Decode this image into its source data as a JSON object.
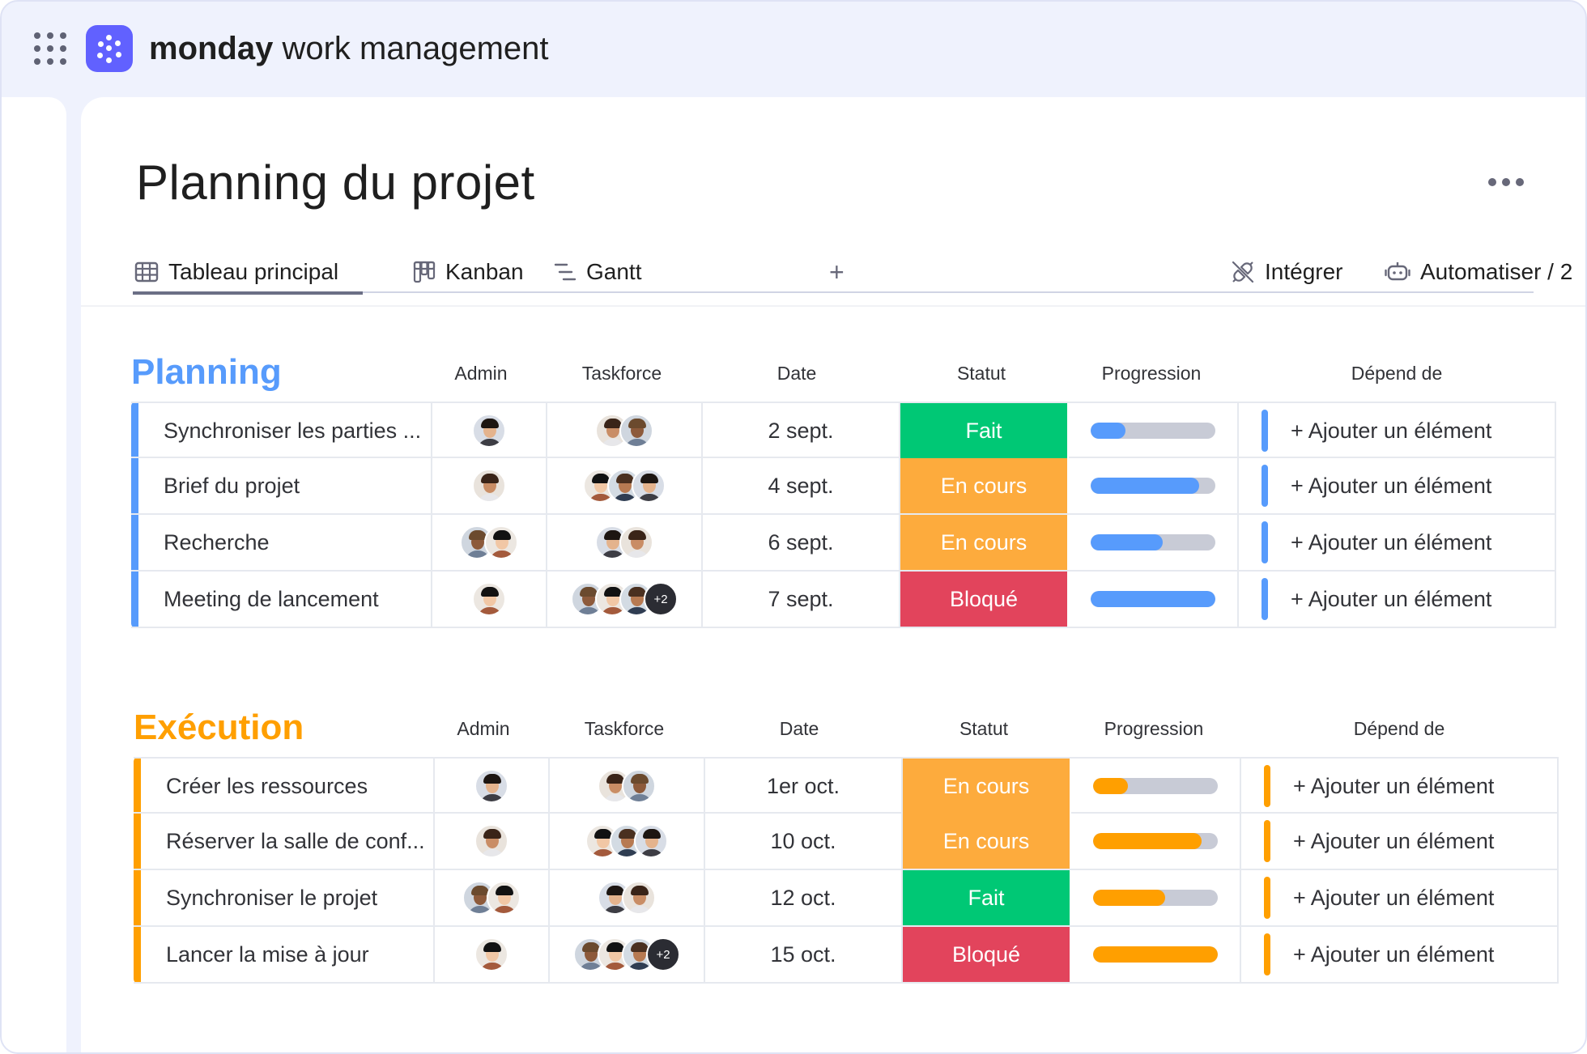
{
  "app": {
    "brand_bold": "monday",
    "brand_rest": " work management"
  },
  "page": {
    "title": "Planning du projet"
  },
  "tabs": [
    {
      "label": "Tableau principal",
      "icon": "table-icon",
      "active": true
    },
    {
      "label": "Kanban",
      "icon": "kanban-icon",
      "active": false
    },
    {
      "label": "Gantt",
      "icon": "gantt-icon",
      "active": false
    }
  ],
  "add_tab_label": "+",
  "actions": {
    "integrate": "Intégrer",
    "automate": "Automatiser / 2"
  },
  "columns": {
    "admin": "Admin",
    "taskforce": "Taskforce",
    "date": "Date",
    "status": "Statut",
    "progress": "Progression",
    "depends": "Dépend de"
  },
  "colors": {
    "planning": "#579bfc",
    "execution": "#ff9f00",
    "done": "#00c875",
    "working": "#fdab3d",
    "stuck": "#e2445c",
    "bar_bg": "#c8cbd6"
  },
  "groups": [
    {
      "title": "Planning",
      "rows": [
        {
          "name": "Synchroniser les parties ...",
          "date": "2 sept.",
          "status": "Fait",
          "progress": 0.28,
          "depends": "+ Ajouter un élément"
        },
        {
          "name": "Brief du projet",
          "date": "4 sept.",
          "status": "En cours",
          "progress": 0.87,
          "depends": "+ Ajouter un élément"
        },
        {
          "name": "Recherche",
          "date": "6 sept.",
          "status": "En cours",
          "progress": 0.58,
          "depends": "+ Ajouter un élément"
        },
        {
          "name": "Meeting de lancement",
          "date": "7 sept.",
          "status": "Bloqué",
          "progress": 1.0,
          "depends": "+ Ajouter un élément"
        }
      ],
      "extra_count": "+2"
    },
    {
      "title": "Exécution",
      "rows": [
        {
          "name": "Créer les ressources",
          "date": "1er oct.",
          "status": "En cours",
          "progress": 0.28,
          "depends": "+ Ajouter un élément"
        },
        {
          "name": "Réserver la salle de conf...",
          "date": "10 oct.",
          "status": "En cours",
          "progress": 0.87,
          "depends": "+ Ajouter un élément"
        },
        {
          "name": "Synchroniser le projet",
          "date": "12 oct.",
          "status": "Fait",
          "progress": 0.58,
          "depends": "+ Ajouter un élément"
        },
        {
          "name": "Lancer la mise à jour",
          "date": "15 oct.",
          "status": "Bloqué",
          "progress": 1.0,
          "depends": "+ Ajouter un élément"
        }
      ],
      "extra_count": "+2"
    }
  ]
}
